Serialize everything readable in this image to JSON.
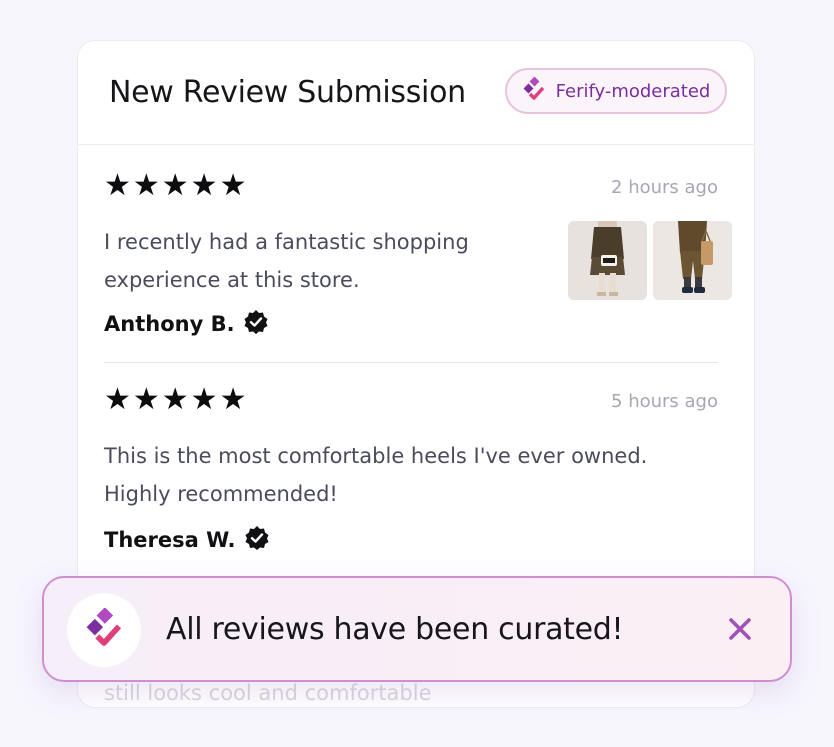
{
  "header": {
    "title": "New Review Submission",
    "badge_label": "Ferify-moderated"
  },
  "reviews": [
    {
      "rating": "★★★★★",
      "time": "2 hours ago",
      "text": "I recently had a fantastic shopping experience at this store.",
      "author": "Anthony B.",
      "verified": true,
      "photos": [
        "photo-handbag-outfit",
        "photo-tote-outfit"
      ]
    },
    {
      "rating": "★★★★★",
      "time": "5 hours ago",
      "text": "This is the most comfortable heels I've ever owned. Highly recommended!",
      "author": "Theresa W.",
      "verified": true
    }
  ],
  "partial_review_text": "still looks cool and comfortable",
  "toast": {
    "message": "All reviews have been curated!",
    "close_icon": "close-icon"
  },
  "colors": {
    "brand_purple": "#7a2ea0",
    "brand_pink": "#e0407a",
    "toast_border": "#cf8fcf",
    "close_icon": "#a052b5"
  }
}
